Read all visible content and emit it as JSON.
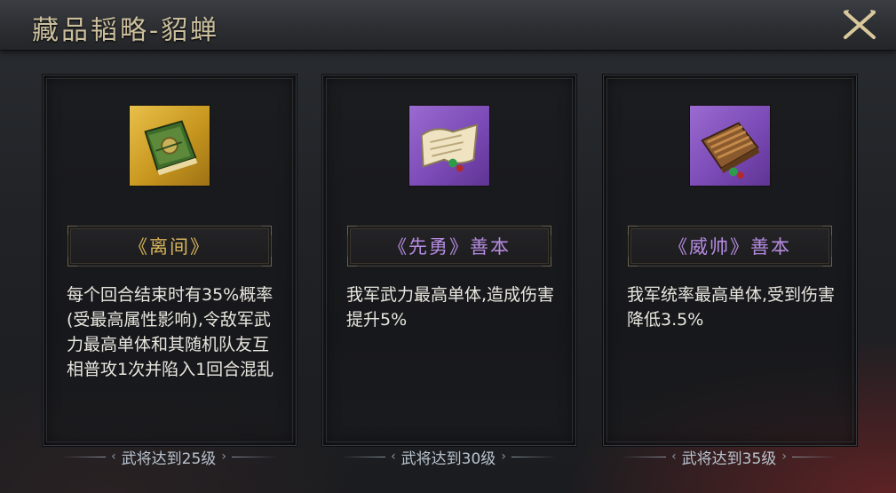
{
  "header": {
    "title": "藏品韬略-貂蝉",
    "close_icon": "close-x-icon"
  },
  "cards": [
    {
      "icon": "gold-book-icon",
      "icon_color": "#d9ad33",
      "name": "《离间》",
      "name_color": "#d8b45a",
      "description": "每个回合结束时有35%概率(受最高属性影响),令敌军武力最高单体和其随机队友互相普攻1次并陷入1回合混乱",
      "requirement": "武将达到25级"
    },
    {
      "icon": "scroll-icon",
      "icon_color": "#7c4bb7",
      "name": "《先勇》善本",
      "name_color": "#b58be0",
      "description": "我军武力最高单体,造成伤害提升5%",
      "requirement": "武将达到30级"
    },
    {
      "icon": "bamboo-book-icon",
      "icon_color": "#7c4bb7",
      "name": "《威帅》善本",
      "name_color": "#b58be0",
      "description": "我军统率最高单体,受到伤害降低3.5%",
      "requirement": "武将达到35级"
    }
  ]
}
